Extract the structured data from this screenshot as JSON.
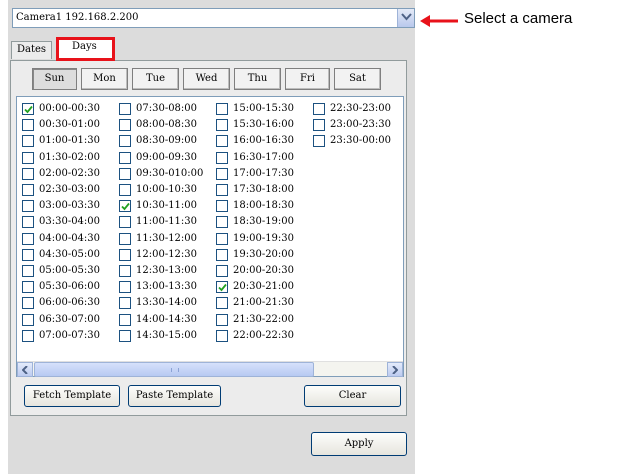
{
  "camera": {
    "selected": "Camera1 192.168.2.200"
  },
  "callout": {
    "label": "Select a camera",
    "color": "#e8121a"
  },
  "tabs": [
    {
      "label": "Dates",
      "active": false
    },
    {
      "label": "Days",
      "active": true
    }
  ],
  "days": [
    "Sun",
    "Mon",
    "Tue",
    "Wed",
    "Thu",
    "Fri",
    "Sat"
  ],
  "selected_day": "Sun",
  "slots": [
    [
      {
        "label": "00:00-00:30",
        "checked": true
      },
      {
        "label": "00:30-01:00",
        "checked": false
      },
      {
        "label": "01:00-01:30",
        "checked": false
      },
      {
        "label": "01:30-02:00",
        "checked": false
      },
      {
        "label": "02:00-02:30",
        "checked": false
      },
      {
        "label": "02:30-03:00",
        "checked": false
      },
      {
        "label": "03:00-03:30",
        "checked": false
      },
      {
        "label": "03:30-04:00",
        "checked": false
      },
      {
        "label": "04:00-04:30",
        "checked": false
      },
      {
        "label": "04:30-05:00",
        "checked": false
      },
      {
        "label": "05:00-05:30",
        "checked": false
      },
      {
        "label": "05:30-06:00",
        "checked": false
      },
      {
        "label": "06:00-06:30",
        "checked": false
      },
      {
        "label": "06:30-07:00",
        "checked": false
      },
      {
        "label": "07:00-07:30",
        "checked": false
      }
    ],
    [
      {
        "label": "07:30-08:00",
        "checked": false
      },
      {
        "label": "08:00-08:30",
        "checked": false
      },
      {
        "label": "08:30-09:00",
        "checked": false
      },
      {
        "label": "09:00-09:30",
        "checked": false
      },
      {
        "label": "09:30-010:00",
        "checked": false
      },
      {
        "label": "10:00-10:30",
        "checked": false
      },
      {
        "label": "10:30-11:00",
        "checked": true
      },
      {
        "label": "11:00-11:30",
        "checked": false
      },
      {
        "label": "11:30-12:00",
        "checked": false
      },
      {
        "label": "12:00-12:30",
        "checked": false
      },
      {
        "label": "12:30-13:00",
        "checked": false
      },
      {
        "label": "13:00-13:30",
        "checked": false
      },
      {
        "label": "13:30-14:00",
        "checked": false
      },
      {
        "label": "14:00-14:30",
        "checked": false
      },
      {
        "label": "14:30-15:00",
        "checked": false
      }
    ],
    [
      {
        "label": "15:00-15:30",
        "checked": false
      },
      {
        "label": "15:30-16:00",
        "checked": false
      },
      {
        "label": "16:00-16:30",
        "checked": false
      },
      {
        "label": "16:30-17:00",
        "checked": false
      },
      {
        "label": "17:00-17:30",
        "checked": false
      },
      {
        "label": "17:30-18:00",
        "checked": false
      },
      {
        "label": "18:00-18:30",
        "checked": false
      },
      {
        "label": "18:30-19:00",
        "checked": false
      },
      {
        "label": "19:00-19:30",
        "checked": false
      },
      {
        "label": "19:30-20:00",
        "checked": false
      },
      {
        "label": "20:00-20:30",
        "checked": false
      },
      {
        "label": "20:30-21:00",
        "checked": true
      },
      {
        "label": "21:00-21:30",
        "checked": false
      },
      {
        "label": "21:30-22:00",
        "checked": false
      },
      {
        "label": "22:00-22:30",
        "checked": false
      }
    ],
    [
      {
        "label": "22:30-23:00",
        "checked": false
      },
      {
        "label": "23:00-23:30",
        "checked": false
      },
      {
        "label": "23:30-00:00",
        "checked": false
      }
    ]
  ],
  "buttons": {
    "fetch": "Fetch Template",
    "paste": "Paste Template",
    "clear": "Clear",
    "apply": "Apply"
  },
  "scrollbar": {
    "position_fraction": 0.0
  }
}
